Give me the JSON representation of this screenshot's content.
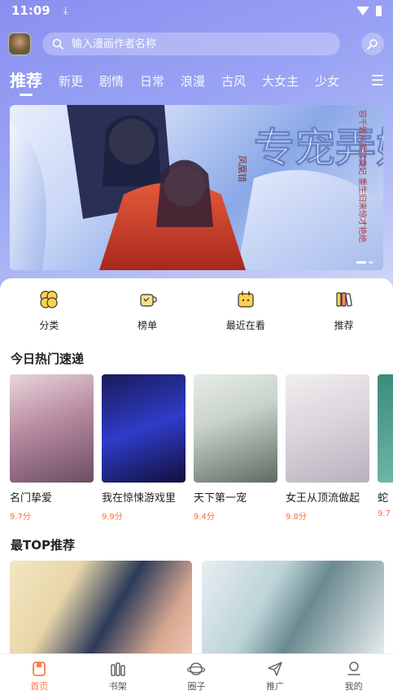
{
  "status_bar": {
    "time": "11:09"
  },
  "search": {
    "placeholder": "输入漫画作者名称"
  },
  "tabs": [
    {
      "label": "推荐"
    },
    {
      "label": "新更"
    },
    {
      "label": "剧情"
    },
    {
      "label": "日常"
    },
    {
      "label": "浪漫"
    },
    {
      "label": "古风"
    },
    {
      "label": "大女主"
    },
    {
      "label": "少女"
    }
  ],
  "banner": {
    "title": "专宠弄妃",
    "subtitle": "凤凰错",
    "tagline": "容千毁从后宫变妃 重生归来惊才艳绝"
  },
  "quick_links": [
    {
      "label": "分类",
      "icon": "category-icon"
    },
    {
      "label": "榜单",
      "icon": "ranking-icon"
    },
    {
      "label": "最近在看",
      "icon": "calendar-icon"
    },
    {
      "label": "推荐",
      "icon": "books-icon"
    }
  ],
  "hot_section": {
    "title": "今日热门速递",
    "items": [
      {
        "title": "名门挚爱",
        "score": "9.7分"
      },
      {
        "title": "我在惊悚游戏里",
        "score": "9.9分"
      },
      {
        "title": "天下第一宠",
        "score": "9.4分"
      },
      {
        "title": "女王从顶流做起",
        "score": "9.8分"
      },
      {
        "title": "蛇",
        "score": "9.7"
      }
    ]
  },
  "top_section": {
    "title": "最TOP推荐"
  },
  "bottom_nav": [
    {
      "label": "首页",
      "icon": "home-icon",
      "active": true
    },
    {
      "label": "书架",
      "icon": "bookshelf-icon",
      "active": false
    },
    {
      "label": "圈子",
      "icon": "planet-icon",
      "active": false
    },
    {
      "label": "推广",
      "icon": "paper-plane-icon",
      "active": false
    },
    {
      "label": "我的",
      "icon": "profile-icon",
      "active": false
    }
  ],
  "colors": {
    "accent": "#ff7a4a",
    "score": "#ff6a3a",
    "header_gradient_start": "#8a8ef0"
  }
}
